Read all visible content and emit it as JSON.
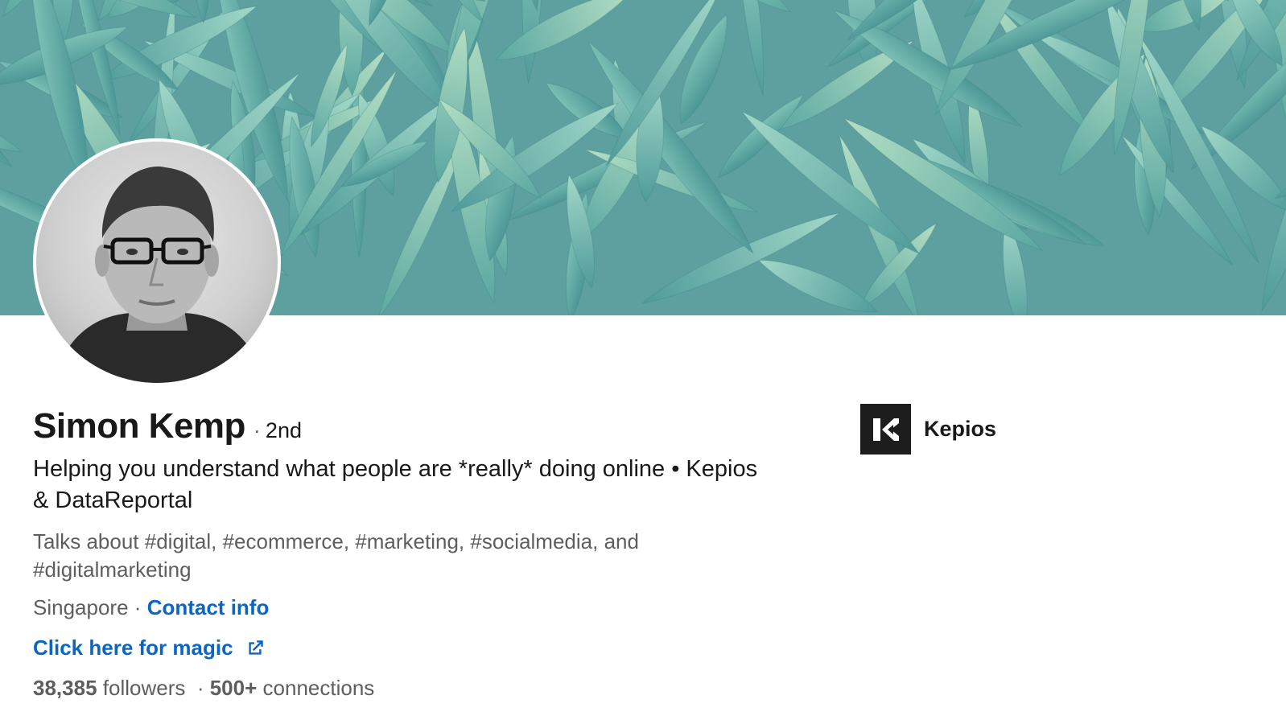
{
  "profile": {
    "name": "Simon Kemp",
    "degree": "2nd",
    "degree_separator": "·",
    "headline": "Helping you understand what people are *really* doing online • Kepios & DataReportal",
    "talks_about": "Talks about #digital, #ecommerce, #marketing, #socialmedia, and #digitalmarketing",
    "location": "Singapore",
    "location_separator": "·",
    "contact_info_label": "Contact info",
    "website_link_label": "Click here for magic",
    "followers_count": "38,385",
    "followers_label": "followers",
    "stats_separator": "·",
    "connections_count": "500+",
    "connections_label": "connections"
  },
  "company": {
    "name": "Kepios",
    "logo_icon": "kepios-logo"
  },
  "colors": {
    "link": "#0a66c2",
    "text_primary": "#191919",
    "text_secondary": "#5e5e5e",
    "cover_tint": "#6fb5ae"
  },
  "icons": {
    "external_link": "external-link-icon"
  }
}
